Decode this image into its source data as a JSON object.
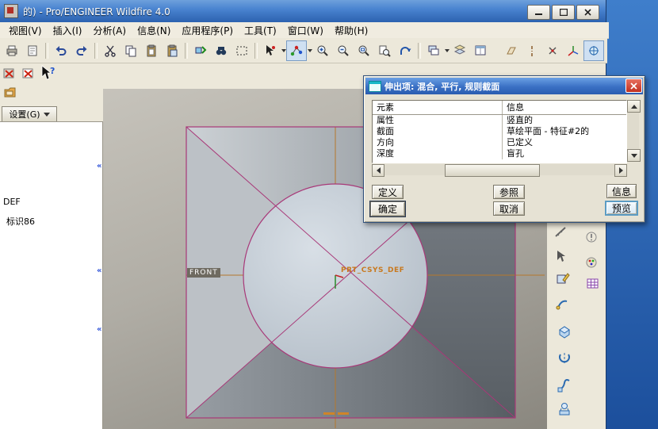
{
  "window": {
    "title": "的) - Pro/ENGINEER Wildfire 4.0"
  },
  "menu": {
    "items": [
      "视图(V)",
      "插入(I)",
      "分析(A)",
      "信息(N)",
      "应用程序(P)",
      "工具(T)",
      "窗口(W)",
      "帮助(H)"
    ]
  },
  "left_panel": {
    "settings_label": "设置(G)",
    "tree_items": [
      "DEF",
      "标识86"
    ]
  },
  "viewport": {
    "front_label": "FRONT",
    "csys_label": "PRT_CSYS_DEF"
  },
  "dialog": {
    "title": "伸出项: 混合, 平行, 规则截面",
    "columns": [
      "元素",
      "信息"
    ],
    "rows": [
      {
        "element": "属性",
        "info": "竖直的"
      },
      {
        "element": "截面",
        "info": "草绘平面 - 特征#2的"
      },
      {
        "element": "方向",
        "info": "已定义"
      },
      {
        "element": "深度",
        "info": "盲孔"
      }
    ],
    "buttons": {
      "define": "定义",
      "refs": "参照",
      "info": "信息",
      "ok": "确定",
      "cancel": "取消",
      "preview": "预览"
    }
  },
  "colors": {
    "titlebar_blue": "#3a76c8",
    "desktop_blue": "#2a63b8",
    "edge_magenta": "#a83878",
    "centerline_orange": "#b5772c",
    "csys_label_orange": "#c8791f",
    "circle_fill": "#c5ced6"
  },
  "icons": [
    "print",
    "plot",
    "undo",
    "redo",
    "cut",
    "copy",
    "paste",
    "paste-special",
    "regenerate",
    "find",
    "select-box",
    "selection-filter",
    "snap-mode",
    "zoom-in",
    "zoom-out",
    "refit",
    "zoom-page",
    "reorient",
    "saved-views",
    "layers",
    "view-manager",
    "datum-plane-toggle",
    "datum-axis-toggle",
    "datum-point-toggle",
    "datum-csys-toggle",
    "spin-center-toggle",
    "close-red-a",
    "close-red-b",
    "help-cursor",
    "folder-tab",
    "measure",
    "annotate",
    "select-arrow",
    "sketch",
    "grid",
    "palette",
    "extrude",
    "revolve",
    "sweep",
    "blend"
  ]
}
